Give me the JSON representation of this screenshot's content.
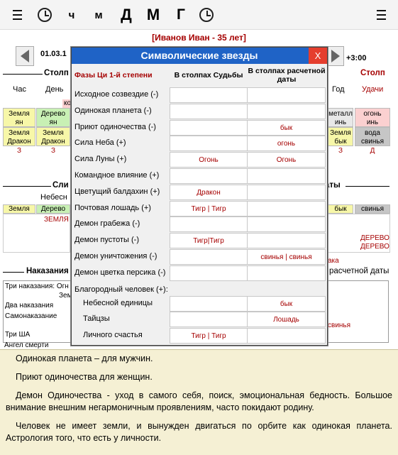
{
  "toolbar": {
    "ch": "ч",
    "m": "м",
    "d": "Д",
    "mm": "М",
    "g": "Г"
  },
  "person": "[Иванов Иван - 35 лет]",
  "date_partial": "01.03.1",
  "zone": "+3:00",
  "bg": {
    "stolp_left": "Столп",
    "stolp_right": "Столп",
    "cols": [
      "Час",
      "День"
    ],
    "right_cols": [
      "Год",
      "Удачи"
    ],
    "ko": "ко",
    "row1": [
      "Земля",
      "ян",
      "Дерево",
      "ян"
    ],
    "row2": [
      "Земля",
      "Дракон",
      "Земля",
      "Дракон"
    ],
    "row3": [
      "З",
      "З"
    ],
    "rrow1": [
      "металл",
      "инь",
      "огонь",
      "инь"
    ],
    "rrow2": [
      "Земля",
      "бык",
      "вода",
      "свинья"
    ],
    "rrow3": [
      "З",
      "Д"
    ],
    "sli": "Сли",
    "nebesn": "Небесн",
    "daty": "аты",
    "z2": [
      "Земля",
      "Дерево",
      "бык",
      "свинья"
    ],
    "zemlya_red": "ЗЕМЛЯ",
    "derevo1": "ДЕРЕВО",
    "derevo2": "ДЕРЕВО",
    "aka": "ака",
    "nakazaniya": "Наказания",
    "raschet": "расчетной даты",
    "tri": "Три наказания: Огн",
    "zem": "Зем",
    "dva": "Два наказания",
    "samo": "Самонаказание",
    "tri_sha": "Три ША",
    "angel": "Ангел смерти",
    "svinya": "свинья"
  },
  "modal": {
    "title": "Символические звезды",
    "close": "X",
    "h1": "Фазы Ци 1-й степени",
    "h2": "В столпах Судьбы",
    "h3": "В столпах расчетной даты",
    "rows": [
      {
        "label": "Исходное созвездие (-)",
        "a": "",
        "b": ""
      },
      {
        "label": "Одинокая планета (-)",
        "a": "",
        "b": ""
      },
      {
        "label": "Приют одиночества (-)",
        "a": "",
        "b": "бык"
      },
      {
        "label": "Сила Неба (+)",
        "a": "",
        "b": "огонь"
      },
      {
        "label": "Сила Луны (+)",
        "a": "Огонь",
        "b": "Огонь"
      },
      {
        "label": "Командное влияние (+)",
        "a": "",
        "b": ""
      },
      {
        "label": "Цветущий балдахин (+)",
        "a": "Дракон",
        "b": ""
      },
      {
        "label": "Почтовая лошадь (+)",
        "a": "Тигр | Тигр",
        "b": ""
      },
      {
        "label": "Демон грабежа (-)",
        "a": "",
        "b": ""
      },
      {
        "label": "Демон пустоты (-)",
        "a": "Тигр|Тигр",
        "b": ""
      },
      {
        "label": "Демон уничтожения (-)",
        "a": "",
        "b": "свинья | свинья"
      },
      {
        "label": "Демон цветка персика (-)",
        "a": "",
        "b": ""
      }
    ],
    "noble": "Благородный человек (+):",
    "subrows": [
      {
        "label": "Небесной единицы",
        "a": "",
        "b": "бык"
      },
      {
        "label": "Тайцзы",
        "a": "",
        "b": "Лошадь"
      },
      {
        "label": "Личного счастья",
        "a": "Тигр | Тигр",
        "b": ""
      }
    ]
  },
  "bottom": [
    "Одинокая планета – для мужчин.",
    "Приют одиночества для женщин.",
    "Демон Одиночества - уход в самого себя, поиск, эмоциональная бедность. Большое внимание внешним негармоничным проявлениям, часто покидают родину.",
    "Человек не имеет земли, и вынужден двигаться по орбите как одинокая планета. Астрология того, что есть у личности."
  ]
}
